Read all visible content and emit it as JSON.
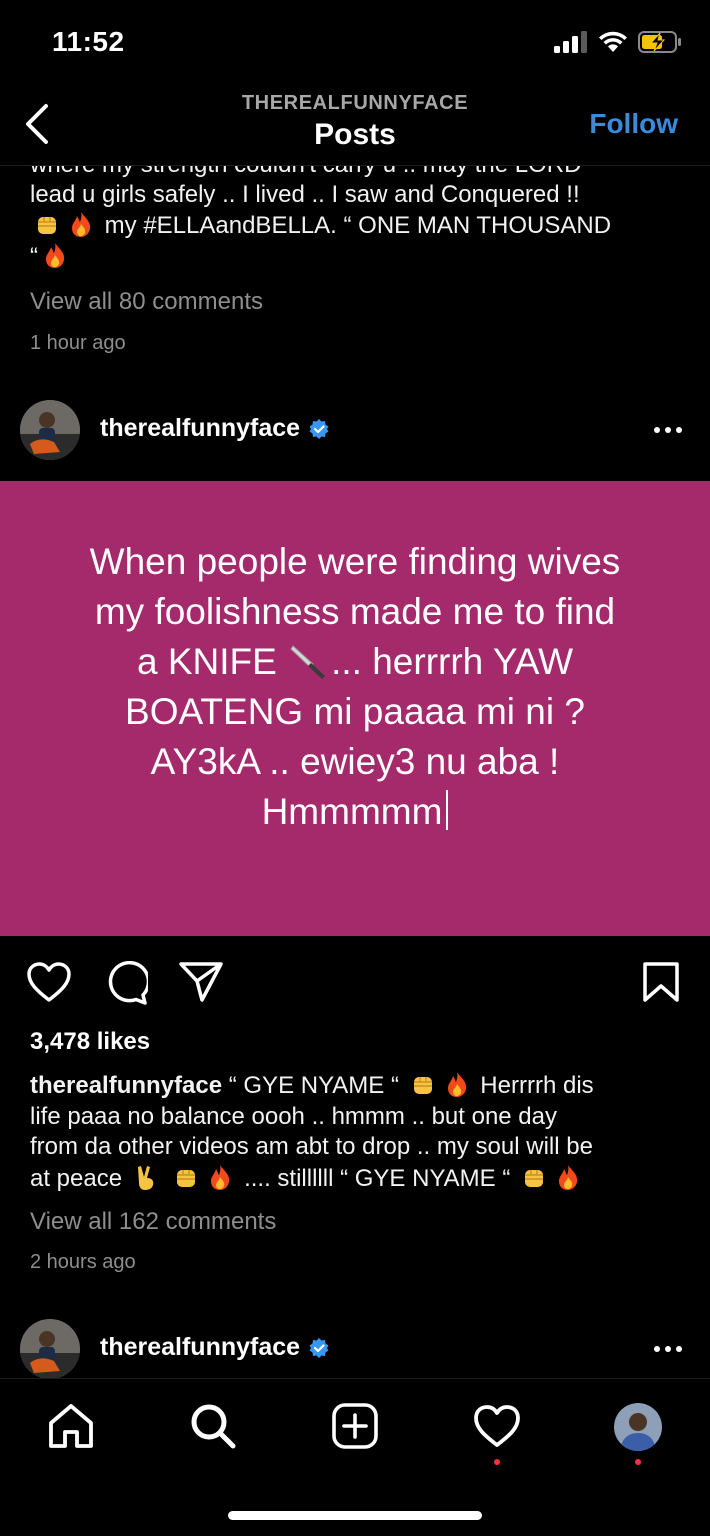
{
  "status_bar": {
    "time": "11:52"
  },
  "header": {
    "account": "THEREALFUNNYFACE",
    "title": "Posts",
    "follow_label": "Follow"
  },
  "previous_post": {
    "caption_lines": [
      "where my strength couldn't carry u .. may the LORD",
      "lead u girls safely .. I lived .. I saw and Conquered !!"
    ],
    "caption_line3_text": "my #ELLAandBELLA. “ ONE MAN THOUSAND",
    "caption_line4_text": "“",
    "view_comments": "View all 80 comments",
    "time_ago": "1 hour ago"
  },
  "post": {
    "username": "therealfunnyface",
    "image_text": {
      "line1": "When people were finding wives",
      "line2": "my foolishness made me to find",
      "line3a": "a KNIFE",
      "line3b": "... herrrrh YAW",
      "line4": "BOATENG mi paaaa mi ni ?",
      "line5": "AY3kA .. ewiey3 nu aba !",
      "line6": "Hmmmmm"
    },
    "image_background": "#a52a6c",
    "likes": "3,478 likes",
    "caption_user": "therealfunnyface",
    "caption_part1": " “ GYE NYAME “",
    "caption_part2": " Herrrrh dis",
    "caption_line2": "life paaa no balance oooh .. hmmm .. but one day",
    "caption_line3": "from da other videos am abt to drop .. my soul will be",
    "caption_line4a": "at peace",
    "caption_line4b": ".... stillllll “ GYE NYAME “",
    "view_comments": "View all 162 comments",
    "time_ago": "2 hours ago"
  },
  "next_post": {
    "username": "therealfunnyface"
  },
  "icons": {
    "back": "chevron-left-icon",
    "more": "more-horizontal-icon",
    "like": "heart-icon",
    "comment": "comment-icon",
    "share": "send-icon",
    "save": "bookmark-icon",
    "verified": "verified-badge-icon"
  },
  "colors": {
    "accent": "#3a8bdc",
    "verified": "#3897f0",
    "notification_dot": "#ff3040",
    "muted_text": "#8e8e8e"
  },
  "bottom_nav": {
    "tabs": [
      "home-icon",
      "search-icon",
      "create-post-icon",
      "activity-icon",
      "profile-avatar"
    ]
  }
}
